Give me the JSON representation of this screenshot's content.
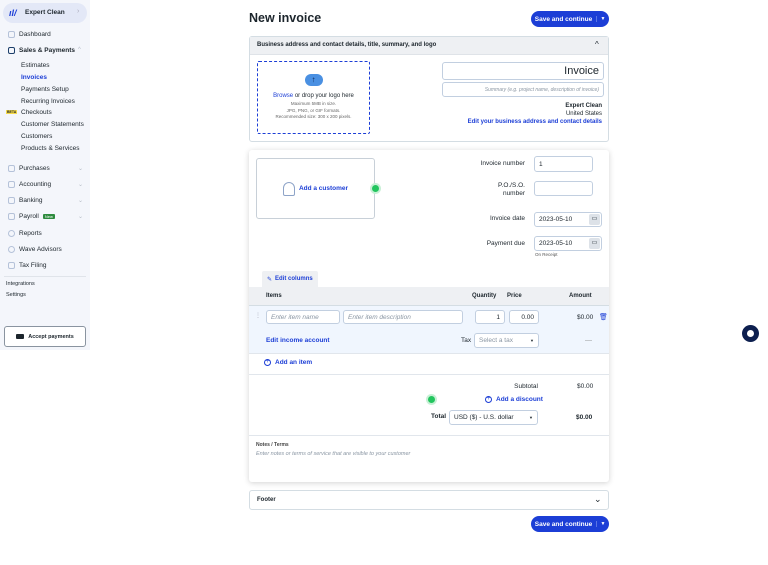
{
  "sidebar": {
    "business": "Expert Clean",
    "items": [
      {
        "label": "Dashboard"
      },
      {
        "label": "Sales & Payments"
      },
      {
        "label": "Purchases"
      },
      {
        "label": "Accounting"
      },
      {
        "label": "Banking"
      },
      {
        "label": "Payroll"
      },
      {
        "label": "Reports"
      },
      {
        "label": "Wave Advisors"
      },
      {
        "label": "Tax Filing"
      }
    ],
    "sub_items": [
      {
        "label": "Estimates"
      },
      {
        "label": "Invoices"
      },
      {
        "label": "Payments Setup"
      },
      {
        "label": "Recurring Invoices"
      },
      {
        "label": "Checkouts"
      },
      {
        "label": "Customer Statements"
      },
      {
        "label": "Customers"
      },
      {
        "label": "Products & Services"
      }
    ],
    "beta_badge": "BETA",
    "payroll_badge": "New",
    "footer_links": [
      {
        "label": "Integrations"
      },
      {
        "label": "Settings"
      }
    ],
    "accept_payments": "Accept payments"
  },
  "header": {
    "title": "New invoice",
    "save_label": "Save and continue"
  },
  "business_panel": {
    "title": "Business address and contact details, title, summary, and logo",
    "browse": "Browse",
    "drop": " or drop your logo here",
    "hint1": "Maximum 5MB in size.",
    "hint2": "JPG, PNG, or GIF formats.",
    "hint3": "Recommended size: 300 x 200 pixels.",
    "invoice_title": "Invoice",
    "summary_placeholder": "Summary (e.g. project name, description of invoice)",
    "business_name": "Expert Clean",
    "country": "United States",
    "edit_link": "Edit your business address and contact details"
  },
  "invoice": {
    "add_customer": "Add a customer",
    "invoice_number_label": "Invoice number",
    "invoice_number": "1",
    "po_label": "P.O./S.O. number",
    "po_value": "",
    "invoice_date_label": "Invoice date",
    "invoice_date": "2023-05-10",
    "payment_due_label": "Payment due",
    "payment_due": "2023-05-10",
    "due_note": "On Receipt",
    "edit_columns": "Edit columns",
    "columns": {
      "items": "Items",
      "quantity": "Quantity",
      "price": "Price",
      "amount": "Amount"
    },
    "item": {
      "name_placeholder": "Enter item name",
      "desc_placeholder": "Enter item description",
      "quantity": "1",
      "price": "0.00",
      "amount": "$0.00",
      "edit_income": "Edit income account",
      "tax_label": "Tax",
      "tax_placeholder": "Select a tax",
      "tax_amount": "—"
    },
    "add_item": "Add an item",
    "subtotal_label": "Subtotal",
    "subtotal": "$0.00",
    "add_discount": "Add a discount",
    "total_label": "Total",
    "currency": "USD ($) - U.S. dollar",
    "total": "$0.00",
    "notes_label": "Notes / Terms",
    "notes_placeholder": "Enter notes or terms of service that are visible to your customer"
  },
  "footer_panel": {
    "title": "Footer"
  },
  "colors": {
    "primary": "#1c3ed6",
    "sidebar_bg": "#f4f6fb",
    "success": "#22c55e"
  }
}
